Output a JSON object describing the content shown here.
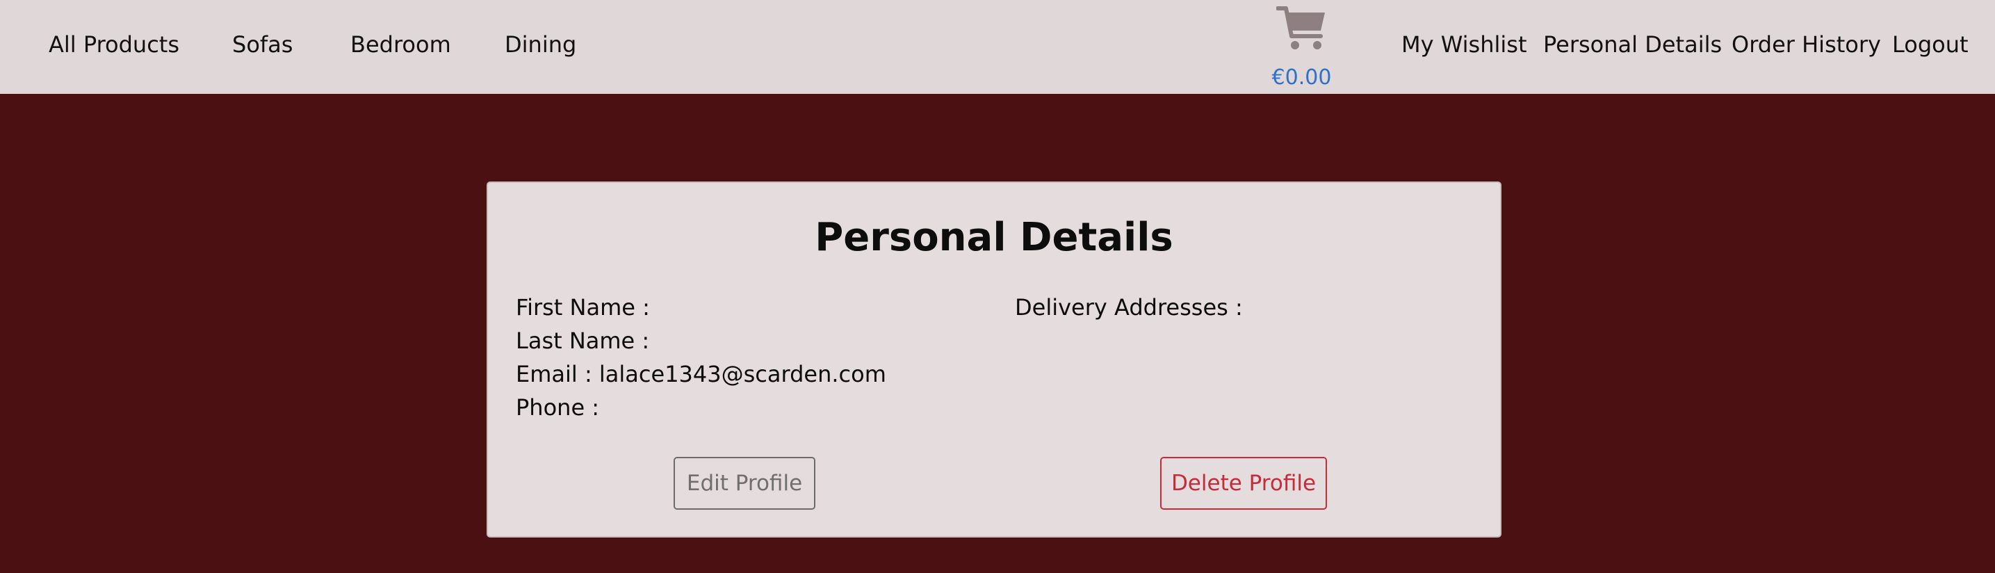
{
  "nav": {
    "left_items": [
      {
        "label": "All Products"
      },
      {
        "label": "Sofas"
      },
      {
        "label": "Bedroom"
      },
      {
        "label": "Dining"
      }
    ],
    "cart": {
      "icon": "shopping-cart-icon",
      "total": "€0.00"
    },
    "right_items": [
      {
        "label": "My Wishlist"
      },
      {
        "label": "Personal Details"
      },
      {
        "label": "Order History"
      },
      {
        "label": "Logout"
      }
    ]
  },
  "profile": {
    "title": "Personal Details",
    "first_name_label": "First Name :",
    "last_name_label": "Last Name :",
    "email_text": "Email : lalace1343@scarden.com",
    "phone_label": "Phone :",
    "delivery_addresses_label": "Delivery Addresses :",
    "edit_button": "Edit Profile",
    "delete_button": "Delete Profile"
  },
  "colors": {
    "background": "#4a1012",
    "navbar": "#e0d8d8",
    "card": "#e4dcdd",
    "cart_total": "#2d71c9",
    "delete_accent": "#c62b3a",
    "edit_accent": "#6c6c6c"
  }
}
